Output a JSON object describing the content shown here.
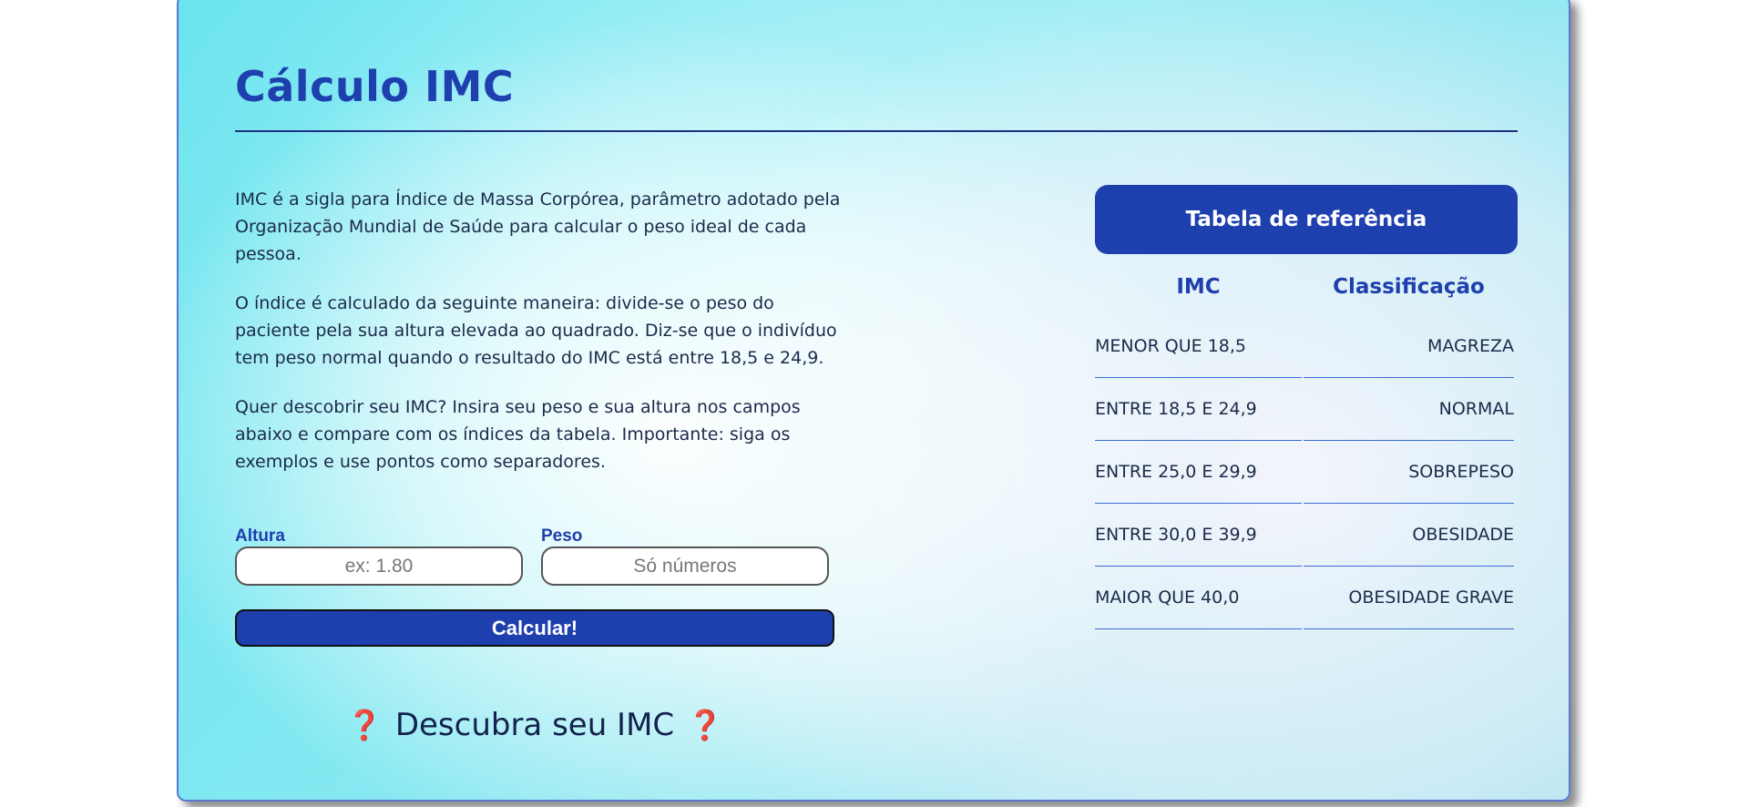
{
  "page": {
    "title": "Cálculo IMC"
  },
  "intro": {
    "paragraphs": [
      "IMC é a sigla para Índice de Massa Corpórea, parâmetro adotado pela Organização Mundial de Saúde para calcular o peso ideal de cada pessoa.",
      "O índice é calculado da seguinte maneira: divide-se o peso do paciente pela sua altura elevada ao quadrado. Diz-se que o indivíduo tem peso normal quando o resultado do IMC está entre 18,5 e 24,9.",
      "Quer descobrir seu IMC? Insira seu peso e sua altura nos campos abaixo e compare com os índices da tabela. Importante: siga os exemplos e use pontos como separadores."
    ]
  },
  "form": {
    "height_label": "Altura",
    "height_placeholder": "ex: 1.80",
    "height_value": "",
    "weight_label": "Peso",
    "weight_placeholder": "Só números",
    "weight_value": "",
    "submit_label": "Calcular!"
  },
  "result": {
    "icon_left": "❓",
    "text": "Descubra seu IMC",
    "icon_right": "❓"
  },
  "reference": {
    "title": "Tabela de referência",
    "columns": [
      "IMC",
      "Classificação"
    ],
    "rows": [
      [
        "MENOR QUE 18,5",
        "MAGREZA"
      ],
      [
        "ENTRE 18,5 E 24,9",
        "NORMAL"
      ],
      [
        "ENTRE 25,0 E 29,9",
        "SOBREPESO"
      ],
      [
        "ENTRE 30,0 E 39,9",
        "OBESIDADE"
      ],
      [
        "MAIOR QUE 40,0",
        "OBESIDADE GRAVE"
      ]
    ]
  },
  "colors": {
    "accent": "#1e3fae",
    "alert_icon": "#e3262e",
    "text": "#1b2a4a"
  }
}
